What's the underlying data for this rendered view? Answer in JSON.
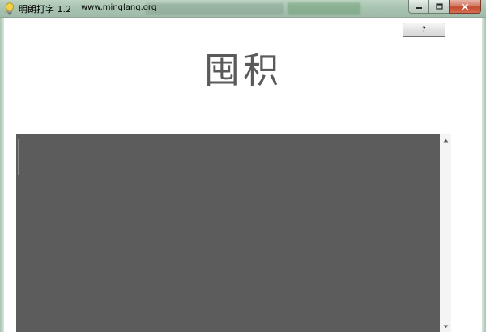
{
  "window": {
    "title": "明朗打字 1.2",
    "url": "www.minglang.org"
  },
  "toolbar": {
    "help_label": "?"
  },
  "main": {
    "current_word": "囤积"
  },
  "icons": {
    "app": "bulb-icon",
    "minimize": "minimize-icon",
    "maximize": "maximize-icon",
    "close": "close-icon",
    "scroll_up": "arrow-up-icon",
    "scroll_down": "arrow-down-icon"
  },
  "colors": {
    "text_area_bg": "#5c5c5c",
    "word_color": "#5a5a5a"
  }
}
